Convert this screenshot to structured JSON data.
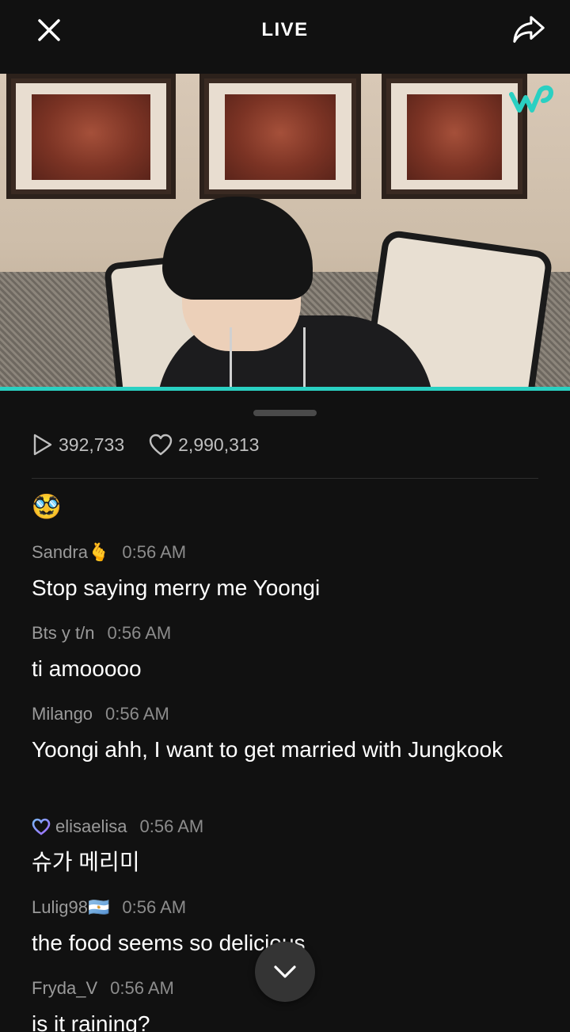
{
  "header": {
    "title": "LIVE",
    "close_icon": "close-icon",
    "share_icon": "share-icon"
  },
  "video": {
    "watermark_icon": "weverse-logo-icon",
    "progress_color": "#2ad0c2"
  },
  "stats": {
    "plays": "392,733",
    "likes": "2,990,313"
  },
  "chat": {
    "emoji_line": "🥸",
    "messages": [
      {
        "name": "Sandra",
        "name_suffix": "🫰",
        "time": "0:56 AM",
        "text": "Stop saying merry me Yoongi"
      },
      {
        "name": "Bts y t/n",
        "name_suffix": "",
        "time": "0:56 AM",
        "text": "ti amooooo"
      },
      {
        "name": "Milango",
        "name_suffix": "",
        "time": "0:56 AM",
        "text": "Yoongi ahh, I want to get married with Jungkook"
      },
      {
        "name": "elisaelisa",
        "name_suffix": "",
        "time": "0:56 AM",
        "text": "슈가 메리미",
        "badge": "heart-badge-icon"
      },
      {
        "name": "Lulig98",
        "name_suffix": "🇦🇷",
        "time": "0:56 AM",
        "text": "the food seems so delicious"
      },
      {
        "name": "Fryda_V",
        "name_suffix": "",
        "time": "0:56 AM",
        "text": "is it raining?"
      }
    ]
  },
  "accent": "#2ad0c2"
}
